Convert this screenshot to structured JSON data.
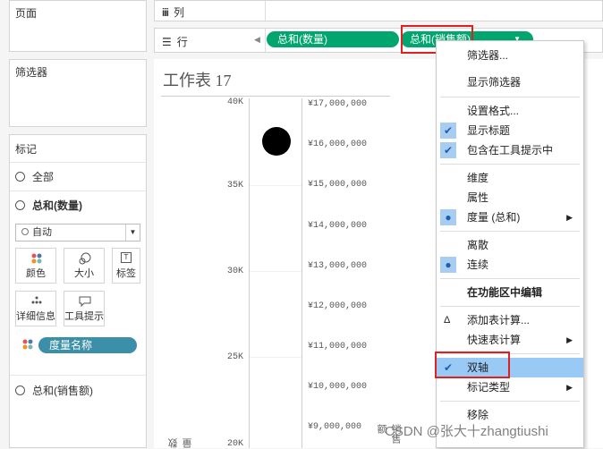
{
  "panels": {
    "pages": "页面",
    "filters": "筛选器",
    "marks": "标记"
  },
  "shelves": {
    "columns_icon": "iii",
    "columns": "列",
    "rows_icon": "☰",
    "rows": "行",
    "pill_quantity": "总和(数量)",
    "pill_sales": "总和(销售额)"
  },
  "marks": {
    "all": "全部",
    "sum_quantity": "总和(数量)",
    "mark_type": "自动",
    "buttons": [
      "颜色",
      "大小",
      "标签",
      "详细信息",
      "工具提示"
    ],
    "measure_names": "度量名称",
    "sum_sales": "总和(销售额)"
  },
  "sheet": {
    "title": "工作表  17",
    "left_axis": [
      "40K",
      "35K",
      "30K",
      "25K",
      "20K"
    ],
    "left_axis_title": "数量",
    "right_axis": [
      "¥17,000,000",
      "¥16,000,000",
      "¥15,000,000",
      "¥14,000,000",
      "¥13,000,000",
      "¥12,000,000",
      "¥11,000,000",
      "¥10,000,000",
      "¥9,000,000"
    ],
    "right_axis_title": "销售额"
  },
  "menu": {
    "items": [
      "筛选器...",
      "显示筛选器",
      "设置格式...",
      "显示标题",
      "包含在工具提示中",
      "维度",
      "属性",
      "度量 (总和)",
      "离散",
      "连续",
      "在功能区中编辑",
      "添加表计算...",
      "快速表计算",
      "双轴",
      "标记类型",
      "移除"
    ],
    "delta_glyph": "Δ"
  },
  "watermark": "CSDN @张大十zhangtiushi",
  "colors": {
    "green_pill": "#00a66e",
    "teal_pill": "#3b8fa8",
    "highlight": "#99c9f5",
    "red_annotation": "#e02020"
  }
}
